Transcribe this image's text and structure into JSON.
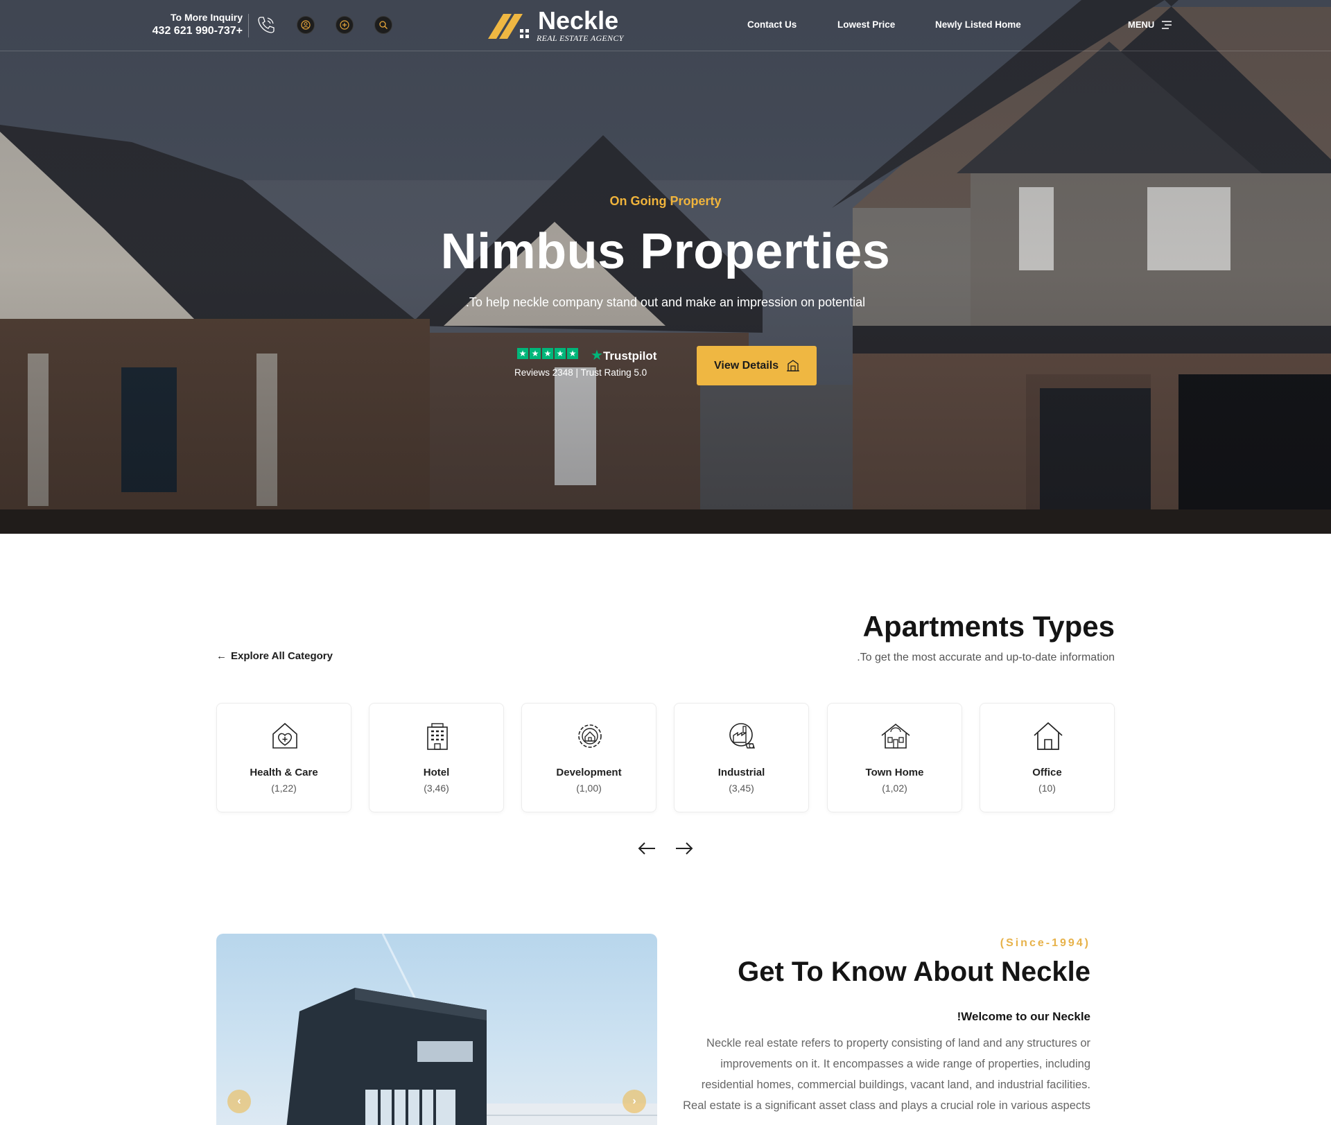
{
  "header": {
    "inquiry_label": "To More Inquiry",
    "inquiry_phone": "432 621 990-737+",
    "brand_name": "Neckle",
    "brand_tagline": "REAL ESTATE AGENCY",
    "nav": [
      "Contact Us",
      "Lowest Price",
      "Newly Listed Home"
    ],
    "menu_label": "MENU"
  },
  "hero": {
    "kicker": "On Going Property",
    "title": "Nimbus Properties",
    "subtitle": ".To help neckle company stand out and make an impression on potential",
    "trustpilot": {
      "brand": "Trustpilot",
      "meta": "Reviews 2348  |  Trust Rating 5.0"
    },
    "cta_label": "View Details"
  },
  "apartments": {
    "title": "Apartments Types",
    "subtitle": ".To get the most accurate and up-to-date information",
    "explore_label": "Explore All Category",
    "cards": [
      {
        "name": "Health & Care",
        "count": "(1,22)",
        "icon": "health-care-icon"
      },
      {
        "name": "Hotel",
        "count": "(3,46)",
        "icon": "hotel-icon"
      },
      {
        "name": "Development",
        "count": "(1,00)",
        "icon": "development-icon"
      },
      {
        "name": "Industrial",
        "count": "(3,45)",
        "icon": "industrial-icon"
      },
      {
        "name": "Town Home",
        "count": "(1,02)",
        "icon": "town-home-icon"
      },
      {
        "name": "Office",
        "count": "(10)",
        "icon": "office-icon"
      }
    ]
  },
  "about": {
    "since": "(Since-1994)",
    "title": "Get To Know About Neckle",
    "welcome": "!Welcome to our Neckle",
    "text": "Neckle real estate refers to property consisting of land and any structures or improvements on it. It encompasses a wide range of properties, including residential homes, commercial buildings, vacant land, and industrial facilities. Real estate is a significant asset class and plays a crucial role in various aspects"
  },
  "colors": {
    "accent": "#efb742",
    "kicker": "#f0b43c",
    "trustpilot_green": "#00b67a",
    "dark": "#141414"
  }
}
